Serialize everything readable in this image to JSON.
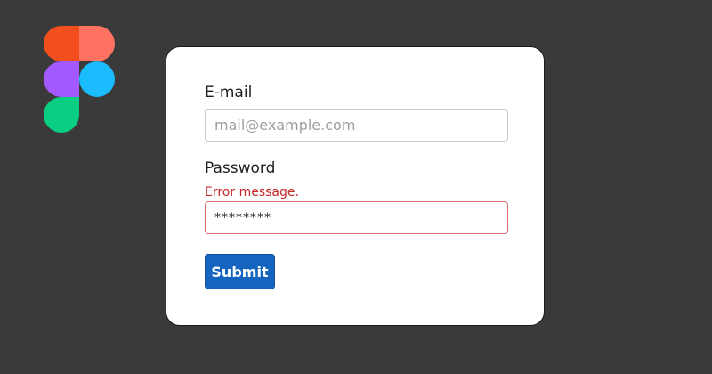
{
  "logo": {
    "icon": "figma-logo",
    "colors": {
      "top_left": "#f24e1e",
      "top_right": "#ff7262",
      "middle_left": "#a259ff",
      "middle_right": "#1abcfe",
      "bottom_left": "#0acf83"
    }
  },
  "form": {
    "email_label": "E-mail",
    "email_placeholder": "mail@example.com",
    "email_value": "",
    "password_label": "Password",
    "password_error": "Error message.",
    "password_value": "********",
    "submit_label": "Submit"
  },
  "colors": {
    "background": "#3a3a3a",
    "card": "#ffffff",
    "error": "#c62828",
    "primary": "#1565c0"
  }
}
